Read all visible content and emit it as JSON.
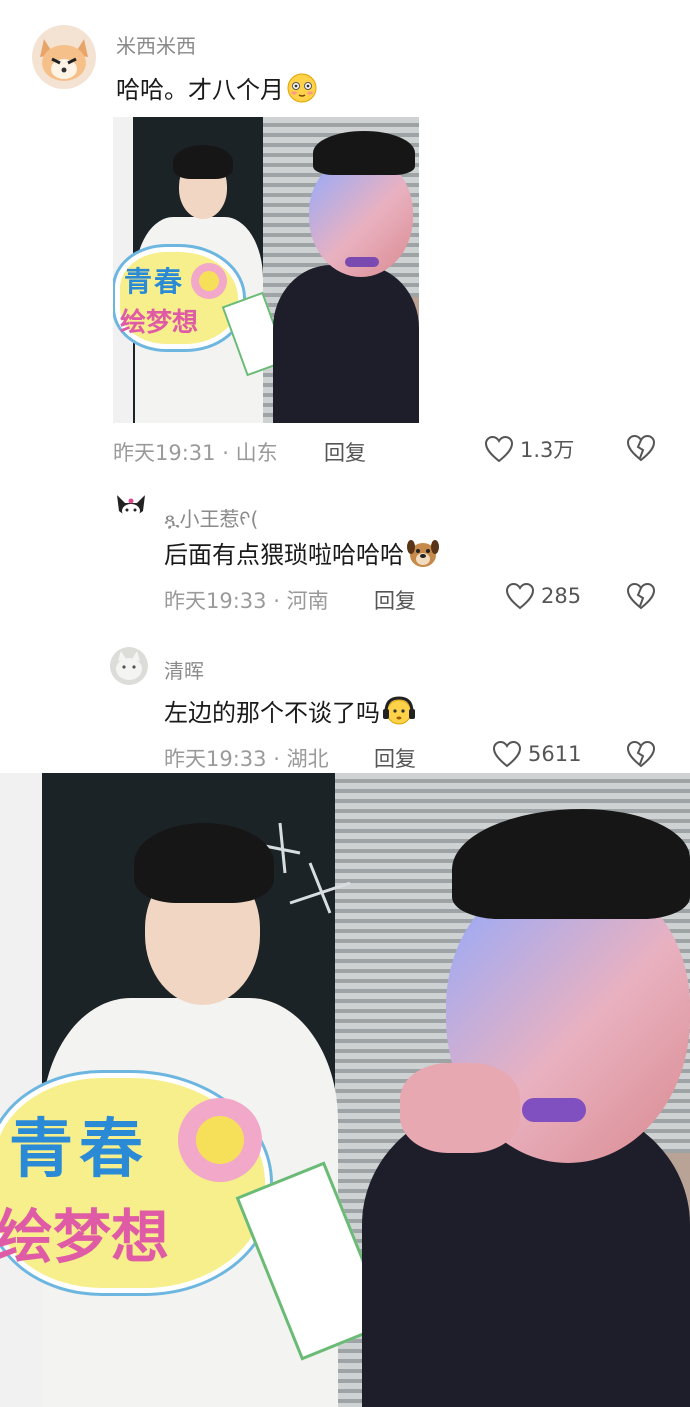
{
  "comments": [
    {
      "username": "米西米西",
      "text": "哈哈。才八个月",
      "time": "昨天19:31",
      "location": "山东",
      "reply_label": "回复",
      "likes": "1.3万"
    },
    {
      "username": "ጿ小王惹ᠻ(",
      "text": "后面有点猥琐啦哈哈哈",
      "time": "昨天19:33",
      "location": "河南",
      "reply_label": "回复",
      "likes": "285"
    },
    {
      "username": "清晖",
      "text": "左边的那个不谈了吗",
      "time": "昨天19:33",
      "location": "湖北",
      "reply_label": "回复",
      "likes": "5611"
    }
  ],
  "photo_sign": {
    "line1": "青春",
    "line2": "绘梦想"
  },
  "icons": {
    "like": "heart-icon",
    "dislike": "broken-heart-icon",
    "emoji1": "blushing-face-emoji",
    "emoji2": "dog-face-emoji",
    "emoji3": "headphones-face-emoji"
  }
}
